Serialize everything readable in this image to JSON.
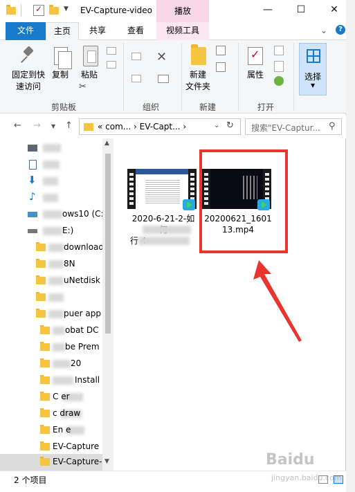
{
  "window": {
    "title": "EV-Capture-video",
    "contextual_tab_header": "播放",
    "controls": {
      "minimize": "—",
      "maximize": "☐",
      "close": "✕"
    }
  },
  "tabs": {
    "file": "文件",
    "home": "主页",
    "share": "共享",
    "view": "查看",
    "video_tools": "视频工具"
  },
  "ribbon": {
    "clipboard": {
      "label": "剪贴板",
      "pin_quick_access": [
        "固定到快",
        "速访问"
      ],
      "copy": "复制",
      "paste": "粘贴"
    },
    "organize": {
      "label": "组织"
    },
    "new": {
      "label": "新建",
      "new_folder": [
        "新建",
        "文件夹"
      ]
    },
    "open": {
      "label": "打开",
      "properties": "属性"
    },
    "select": {
      "label": "选择"
    }
  },
  "address": {
    "path": "«  com...  ›  EV-Capt...  ›",
    "search_placeholder": "搜索\"EV-Captur..."
  },
  "nav_pane": {
    "items": [
      {
        "label": "",
        "icon": "pictures-icon"
      },
      {
        "label": "",
        "icon": "documents-icon"
      },
      {
        "label": "",
        "icon": "downloads-icon"
      },
      {
        "label": "",
        "icon": "music-icon"
      },
      {
        "label": "ows10 (C:",
        "icon": "drive-icon"
      },
      {
        "label": "E:)",
        "icon": "drive-icon"
      },
      {
        "label": "download",
        "icon": "folder-icon"
      },
      {
        "label": "8N",
        "icon": "folder-icon"
      },
      {
        "label": "uNetdisk",
        "icon": "folder-icon"
      },
      {
        "label": "",
        "icon": "folder-icon"
      },
      {
        "label": "puer app",
        "icon": "folder-icon"
      },
      {
        "label": "obat DC",
        "icon": "folder-icon"
      },
      {
        "label": "be Prem",
        "icon": "folder-icon"
      },
      {
        "label": "20",
        "icon": "folder-icon"
      },
      {
        "label": "Install",
        "icon": "folder-icon"
      },
      {
        "label": "C     er",
        "icon": "folder-icon"
      },
      {
        "label": "c      draw",
        "icon": "folder-icon"
      },
      {
        "label": "En      e",
        "icon": "folder-icon"
      },
      {
        "label": "EV-Capture",
        "icon": "folder-icon"
      },
      {
        "label": "EV-Capture-",
        "icon": "folder-icon"
      }
    ]
  },
  "files": [
    {
      "name_lines": [
        "2020-6-21-2-如",
        "何",
        "行              4"
      ]
    },
    {
      "name_lines": [
        "20200621_1601",
        "13.mp4"
      ]
    }
  ],
  "status": {
    "item_count": "2 个项目"
  },
  "watermark": {
    "brand": "Baidu",
    "sub": "jingyan.baidu.com"
  },
  "colors": {
    "accent": "#1979ca",
    "highlight": "#e8362e",
    "context_tab": "#f9d7e9"
  }
}
